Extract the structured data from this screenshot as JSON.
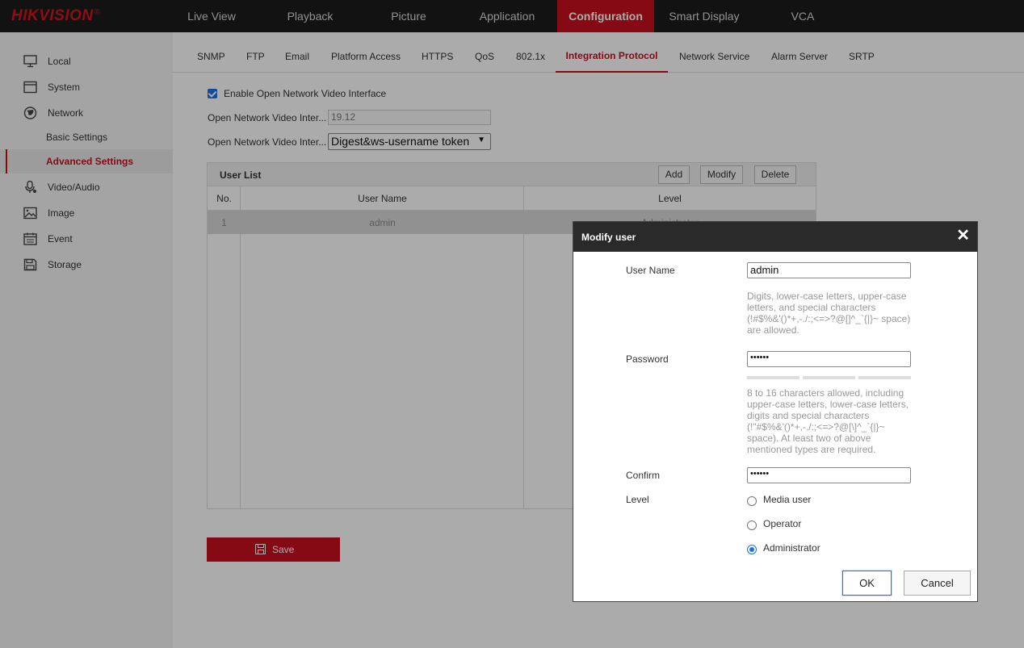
{
  "brand": {
    "logo_text": "HIKVISION",
    "logo_mark": "®",
    "accent_color": "#c8101e"
  },
  "topnav": {
    "items": [
      {
        "label": "Live View"
      },
      {
        "label": "Playback"
      },
      {
        "label": "Picture"
      },
      {
        "label": "Application"
      },
      {
        "label": "Configuration",
        "active": true
      },
      {
        "label": "Smart Display"
      },
      {
        "label": "VCA"
      }
    ]
  },
  "sidebar": {
    "items": [
      {
        "label": "Local",
        "icon": "monitor-icon"
      },
      {
        "label": "System",
        "icon": "system-icon"
      },
      {
        "label": "Network",
        "icon": "globe-icon"
      },
      {
        "label": "Basic Settings",
        "sub": true
      },
      {
        "label": "Advanced Settings",
        "sub": true,
        "active": true
      },
      {
        "label": "Video/Audio",
        "icon": "microphone-icon"
      },
      {
        "label": "Image",
        "icon": "image-icon"
      },
      {
        "label": "Event",
        "icon": "calendar-icon"
      },
      {
        "label": "Storage",
        "icon": "storage-icon"
      }
    ]
  },
  "subtabs": {
    "items": [
      {
        "label": "SNMP"
      },
      {
        "label": "FTP"
      },
      {
        "label": "Email"
      },
      {
        "label": "Platform Access"
      },
      {
        "label": "HTTPS"
      },
      {
        "label": "QoS"
      },
      {
        "label": "802.1x"
      },
      {
        "label": "Integration Protocol",
        "active": true
      },
      {
        "label": "Network Service"
      },
      {
        "label": "Alarm Server"
      },
      {
        "label": "SRTP"
      }
    ]
  },
  "form": {
    "enable_label": "Enable Open Network Video Interface",
    "enable_checked": true,
    "version_label": "Open Network Video Inter...",
    "version_value": "19.12",
    "auth_label": "Open Network Video Inter...",
    "auth_value": "Digest&ws-username token"
  },
  "user_list": {
    "title": "User List",
    "buttons": {
      "add": "Add",
      "modify": "Modify",
      "delete": "Delete"
    },
    "columns": [
      "No.",
      "User Name",
      "Level"
    ],
    "rows": [
      {
        "no": "1",
        "user_name": "admin",
        "level": "Administrator"
      }
    ]
  },
  "save_label": "Save",
  "dialog": {
    "title": "Modify user",
    "close_glyph": "✕",
    "user_name_label": "User Name",
    "user_name_value": "admin",
    "user_name_hint": "Digits, lower-case letters, upper-case letters, and special characters (!#$%&'()*+,-./:;<=>?@[]^_`{|}~ space) are allowed.",
    "password_label": "Password",
    "password_value": "••••••",
    "password_hint": "8 to 16 characters allowed, including upper-case letters, lower-case letters, digits and special characters (!\"#$%&'()*+,-./:;<=>?@[\\]^_`{|}~ space). At least two of above mentioned types are required.",
    "confirm_label": "Confirm",
    "confirm_value": "••••••",
    "level_label": "Level",
    "levels": [
      {
        "label": "Media user",
        "checked": false
      },
      {
        "label": "Operator",
        "checked": false
      },
      {
        "label": "Administrator",
        "checked": true
      }
    ],
    "ok_label": "OK",
    "cancel_label": "Cancel"
  }
}
